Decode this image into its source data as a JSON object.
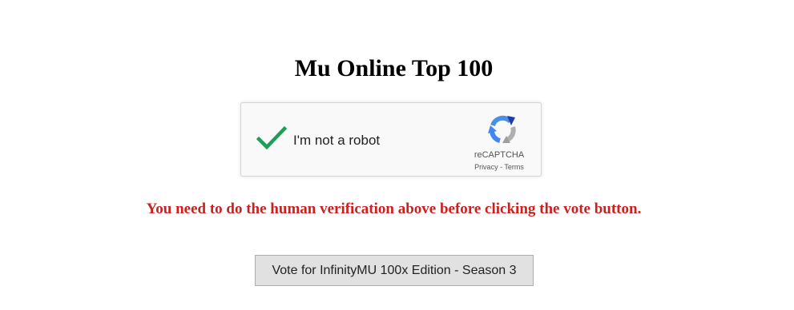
{
  "page": {
    "title": "Mu Online Top 100",
    "warning": "You need to do the human verification above before clicking the vote button.",
    "warning_color": "#cc1f1f"
  },
  "captcha": {
    "label": "I'm not a robot",
    "checked": true,
    "check_icon": "checkmark-icon",
    "check_color": "#1f9e5a",
    "logo_icon": "recaptcha-logo-icon",
    "brand": "reCAPTCHA",
    "privacy_link": "Privacy",
    "separator": " - ",
    "terms_link": "Terms"
  },
  "vote": {
    "button_label": "Vote for InfinityMU 100x Edition - Season 3"
  }
}
